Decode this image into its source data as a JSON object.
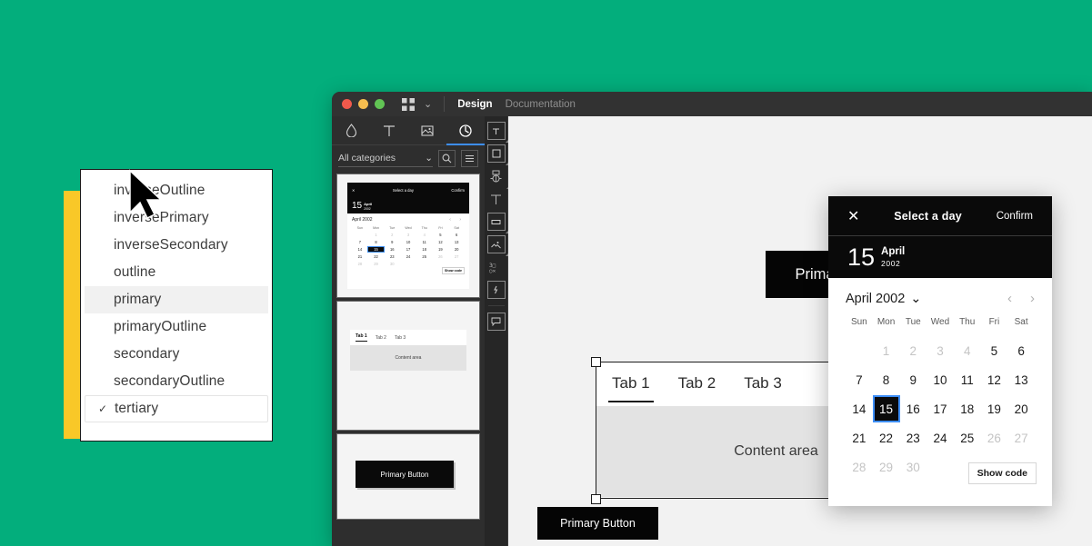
{
  "colors": {
    "background_green": "#03ae7c",
    "accent_yellow": "#f9c828",
    "selection_blue": "#3d8ef7",
    "black": "#0a0a0a"
  },
  "dropdown": {
    "items": [
      {
        "label": "inverseOutline",
        "state": "normal"
      },
      {
        "label": "inversePrimary",
        "state": "normal"
      },
      {
        "label": "inverseSecondary",
        "state": "normal"
      },
      {
        "label": "outline",
        "state": "normal"
      },
      {
        "label": "primary",
        "state": "hovered"
      },
      {
        "label": "primaryOutline",
        "state": "normal"
      },
      {
        "label": "secondary",
        "state": "normal"
      },
      {
        "label": "secondaryOutline",
        "state": "normal"
      },
      {
        "label": "tertiary",
        "state": "selected",
        "check": "✓"
      }
    ]
  },
  "window": {
    "titlebar": {
      "tab_design": "Design",
      "tab_documentation": "Documentation",
      "chevron": "⌄"
    },
    "icon_tabs": [
      {
        "name": "color-droplet-icon",
        "active": false
      },
      {
        "name": "typography-icon",
        "active": false
      },
      {
        "name": "image-icon",
        "active": false
      },
      {
        "name": "components-icon",
        "active": true
      }
    ],
    "filter": {
      "category_label": "All categories",
      "chevron": "⌄",
      "search_icon": "search-icon",
      "list_icon": "list-icon"
    },
    "thumbnails": [
      {
        "name": "date-picker-thumbnail"
      },
      {
        "name": "tabs-thumbnail"
      },
      {
        "name": "primary-button-thumbnail",
        "label": "Primary Button"
      }
    ],
    "tool_rail": [
      "frame-icon",
      "rectangle-icon",
      "component-icon",
      "text-icon",
      "button-icon",
      "image-icon",
      "vector-icon",
      "code-icon",
      "comment-icon"
    ]
  },
  "canvas": {
    "primary_button": "Primary Button",
    "primary_button_small": "Primary Button",
    "tabs": {
      "items": [
        {
          "label": "Tab 1",
          "active": true
        },
        {
          "label": "Tab 2",
          "active": false
        },
        {
          "label": "Tab 3",
          "active": false
        }
      ],
      "content": "Content area"
    },
    "mini_tabs": {
      "items": [
        {
          "label": "Tab 1",
          "active": true
        },
        {
          "label": "Tab 2",
          "active": false
        },
        {
          "label": "Tab 3",
          "active": false
        }
      ],
      "content": "Content area"
    }
  },
  "date_picker": {
    "close_icon": "✕",
    "title": "Select a day",
    "confirm": "Confirm",
    "selected_day_number": "15",
    "selected_month": "April",
    "selected_year": "2002",
    "month_selector": "April 2002",
    "month_chevron": "⌄",
    "prev_icon": "‹",
    "next_icon": "›",
    "weekdays": [
      "Sun",
      "Mon",
      "Tue",
      "Wed",
      "Thu",
      "Fri",
      "Sat"
    ],
    "show_code": "Show code",
    "cells": [
      {
        "d": "",
        "s": "empty"
      },
      {
        "d": "1",
        "s": "dim"
      },
      {
        "d": "2",
        "s": "dim"
      },
      {
        "d": "3",
        "s": "dim"
      },
      {
        "d": "4",
        "s": "dim"
      },
      {
        "d": "5",
        "s": "normal"
      },
      {
        "d": "6",
        "s": "normal"
      },
      {
        "d": "7",
        "s": "normal"
      },
      {
        "d": "8",
        "s": "normal"
      },
      {
        "d": "9",
        "s": "normal"
      },
      {
        "d": "10",
        "s": "normal"
      },
      {
        "d": "11",
        "s": "normal"
      },
      {
        "d": "12",
        "s": "normal"
      },
      {
        "d": "13",
        "s": "normal"
      },
      {
        "d": "14",
        "s": "normal"
      },
      {
        "d": "15",
        "s": "selected"
      },
      {
        "d": "16",
        "s": "normal"
      },
      {
        "d": "17",
        "s": "normal"
      },
      {
        "d": "18",
        "s": "normal"
      },
      {
        "d": "19",
        "s": "normal"
      },
      {
        "d": "20",
        "s": "normal"
      },
      {
        "d": "21",
        "s": "normal"
      },
      {
        "d": "22",
        "s": "normal"
      },
      {
        "d": "23",
        "s": "normal"
      },
      {
        "d": "24",
        "s": "normal"
      },
      {
        "d": "25",
        "s": "normal"
      },
      {
        "d": "26",
        "s": "dim"
      },
      {
        "d": "27",
        "s": "dim"
      },
      {
        "d": "28",
        "s": "dim"
      },
      {
        "d": "29",
        "s": "dim"
      },
      {
        "d": "30",
        "s": "dim"
      },
      {
        "d": "",
        "s": "empty"
      },
      {
        "d": "",
        "s": "empty"
      },
      {
        "d": "",
        "s": "empty"
      },
      {
        "d": "",
        "s": "empty"
      }
    ]
  }
}
